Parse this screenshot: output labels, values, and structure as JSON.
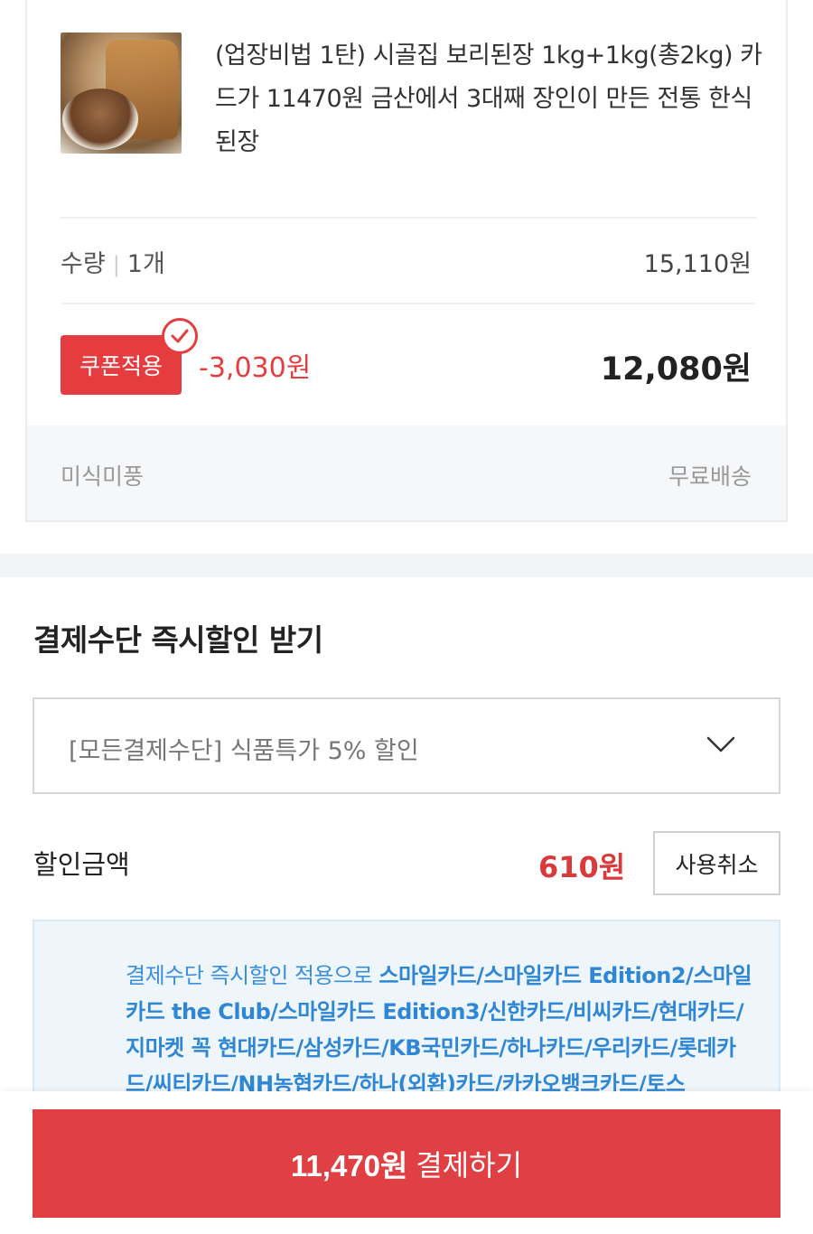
{
  "product": {
    "title": "(업장비법 1탄) 시골집 보리된장 1kg+1kg(총2kg) 카드가 11470원 금산에서 3대째 장인이 만든 전통 한식된장",
    "quantity_label": "수량",
    "quantity_value": "1개",
    "original_price": "15,110원",
    "coupon_label": "쿠폰적용",
    "coupon_discount": "-3,030원",
    "final_price": "12,080원",
    "seller": "미식미풍",
    "shipping": "무료배송"
  },
  "payment_discount": {
    "title": "결제수단 즉시할인 받기",
    "selected_option": "[모든결제수단] 식품특가 5% 할인",
    "discount_label": "할인금액",
    "discount_amount": "610원",
    "cancel_label": "사용취소",
    "info_prefix": "결제수단 즉시할인 적용으로 ",
    "info_cards": "스마일카드/스마일카드 Edition2/스마일카드 the Club/스마일카드 Edition3/신한카드/비씨카드/현대카드/지마켓 꼭 현대카드/삼성카드/KB국민카드/하나카드/우리카드/롯데카드/씨티카드/NH농협카드/하나(외환)카드/카카오뱅크카드/토스"
  },
  "checkout": {
    "amount": "11,470원",
    "label": " 결제하기"
  },
  "colors": {
    "accent_red": "#e53d3f",
    "info_blue": "#3b8fd8"
  }
}
